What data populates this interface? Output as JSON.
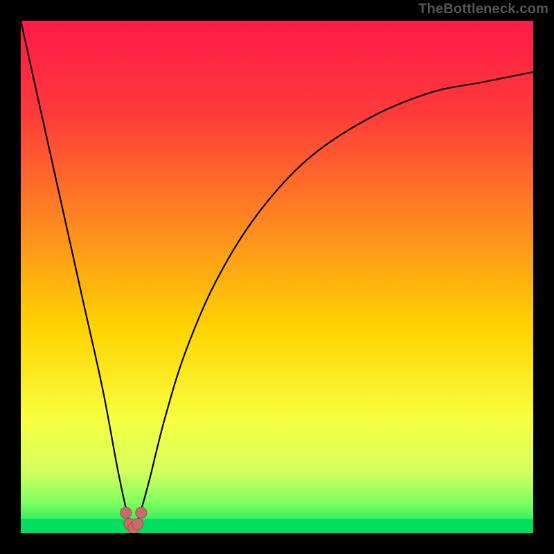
{
  "watermark": "TheBottleneck.com",
  "colors": {
    "frame": "#000000",
    "gradient_stops": [
      {
        "offset": 0.0,
        "color": "#ff1a4a"
      },
      {
        "offset": 0.18,
        "color": "#ff3a3a"
      },
      {
        "offset": 0.4,
        "color": "#ff8a20"
      },
      {
        "offset": 0.6,
        "color": "#ffd400"
      },
      {
        "offset": 0.78,
        "color": "#f8ff40"
      },
      {
        "offset": 0.88,
        "color": "#d4ff60"
      },
      {
        "offset": 0.94,
        "color": "#80ff60"
      },
      {
        "offset": 1.0,
        "color": "#00e060"
      }
    ],
    "green_band": "#00e060",
    "curve": "#000000",
    "marker_fill": "#c96b6b",
    "marker_stroke": "#a94848"
  },
  "chart_data": {
    "type": "line",
    "title": "",
    "xlabel": "",
    "ylabel": "",
    "xlim": [
      0,
      100
    ],
    "ylim": [
      0,
      100
    ],
    "x_optimum": 22,
    "series": [
      {
        "name": "bottleneck-curve",
        "comment": "y ≈ 100 at x=0, drops to ~0 at x≈22, rises back toward ~90 at x=100; right branch is concave (levels off).",
        "x": [
          0,
          4,
          8,
          12,
          16,
          19,
          21,
          22,
          23,
          25,
          28,
          32,
          38,
          46,
          56,
          68,
          80,
          90,
          100
        ],
        "y": [
          100,
          82,
          64,
          46,
          28,
          12,
          3,
          1,
          3,
          10,
          22,
          35,
          49,
          62,
          73,
          81,
          86,
          88,
          90
        ]
      }
    ],
    "markers": {
      "name": "optimum-markers",
      "comment": "small rounded markers forming a short U at the curve minimum",
      "points": [
        {
          "x": 20.5,
          "y": 4.0
        },
        {
          "x": 21.2,
          "y": 1.8
        },
        {
          "x": 22.0,
          "y": 1.0
        },
        {
          "x": 22.8,
          "y": 1.8
        },
        {
          "x": 23.5,
          "y": 4.0
        }
      ]
    }
  }
}
